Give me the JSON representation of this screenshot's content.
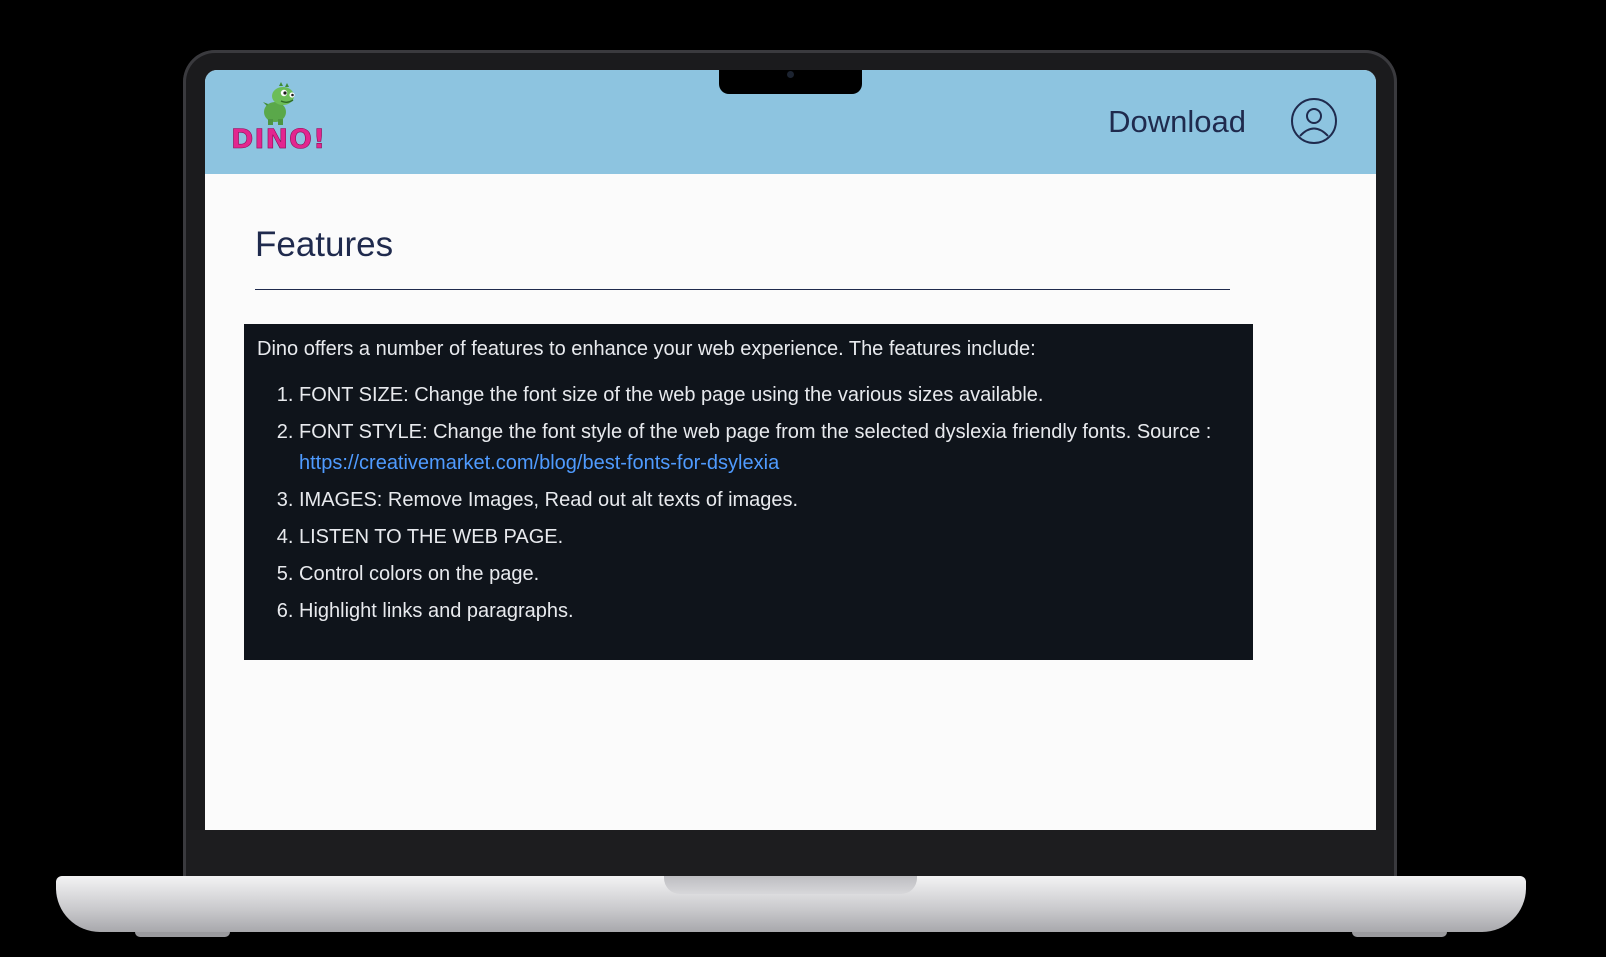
{
  "header": {
    "logo_text": "DINO!",
    "download_label": "Download",
    "profile_icon": "user-circle-icon"
  },
  "main": {
    "title": "Features",
    "intro": "Dino offers a number of features to enhance your web experience. The features include:",
    "features": [
      {
        "text": "FONT SIZE: Change the font size of the web page using the various sizes available."
      },
      {
        "text": "FONT STYLE: Change the font style of the web page from the selected dyslexia friendly fonts. Source :",
        "link": "https://creativemarket.com/blog/best-fonts-for-dsylexia"
      },
      {
        "text": "IMAGES: Remove Images, Read out alt texts of images."
      },
      {
        "text": "LISTEN TO THE WEB PAGE."
      },
      {
        "text": "Control colors on the page."
      },
      {
        "text": "Highlight links and paragraphs."
      }
    ]
  },
  "colors": {
    "header_bg": "#8dc4e0",
    "panel_bg": "#0f141b",
    "link": "#4f9bff",
    "logo": "#e3268f"
  }
}
